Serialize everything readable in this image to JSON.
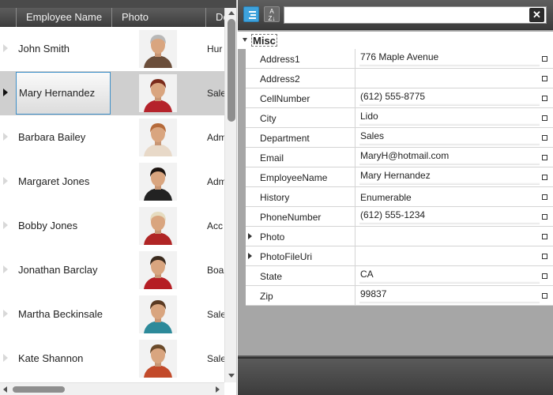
{
  "grid": {
    "columns": [
      "Employee Name",
      "Photo",
      "De"
    ],
    "rows": [
      {
        "name": "John Smith",
        "dept": "Hur",
        "photo_icon": "person-photo-icon",
        "selected": false
      },
      {
        "name": "Mary Hernandez",
        "dept": "Sale",
        "photo_icon": "person-photo-icon",
        "selected": true
      },
      {
        "name": "Barbara Bailey",
        "dept": "Adm",
        "photo_icon": "person-photo-icon",
        "selected": false
      },
      {
        "name": "Margaret Jones",
        "dept": "Adm",
        "photo_icon": "person-photo-icon",
        "selected": false
      },
      {
        "name": "Bobby Jones",
        "dept": "Acc",
        "photo_icon": "person-photo-icon",
        "selected": false
      },
      {
        "name": "Jonathan Barclay",
        "dept": "Boa",
        "photo_icon": "person-photo-icon",
        "selected": false
      },
      {
        "name": "Martha Beckinsale",
        "dept": "Sale",
        "photo_icon": "person-photo-icon",
        "selected": false
      },
      {
        "name": "Kate Shannon",
        "dept": "Sale",
        "photo_icon": "person-photo-icon",
        "selected": false
      }
    ]
  },
  "property_grid": {
    "toolbar": {
      "categorize_icon": "categorize-icon",
      "sort_az_label_top": "A",
      "sort_az_label_bottom": "Z",
      "search_value": "",
      "clear_label": "✕"
    },
    "category": "Misc",
    "properties": [
      {
        "name": "Address1",
        "value": "776 Maple Avenue",
        "editable": true,
        "expandable": false
      },
      {
        "name": "Address2",
        "value": "",
        "editable": false,
        "expandable": false
      },
      {
        "name": "CellNumber",
        "value": "(612) 555-8775",
        "editable": true,
        "expandable": false
      },
      {
        "name": "City",
        "value": "Lido",
        "editable": true,
        "expandable": false
      },
      {
        "name": "Department",
        "value": "Sales",
        "editable": true,
        "expandable": false
      },
      {
        "name": "Email",
        "value": "MaryH@hotmail.com",
        "editable": true,
        "expandable": false
      },
      {
        "name": "EmployeeName",
        "value": "Mary Hernandez",
        "editable": true,
        "expandable": false
      },
      {
        "name": "History",
        "value": "Enumerable",
        "editable": false,
        "expandable": false
      },
      {
        "name": "PhoneNumber",
        "value": "(612) 555-1234",
        "editable": true,
        "expandable": false
      },
      {
        "name": "Photo",
        "value": "",
        "editable": false,
        "expandable": true
      },
      {
        "name": "PhotoFileUri",
        "value": "",
        "editable": false,
        "expandable": true
      },
      {
        "name": "State",
        "value": "CA",
        "editable": true,
        "expandable": false
      },
      {
        "name": "Zip",
        "value": "99837",
        "editable": true,
        "expandable": false
      }
    ]
  }
}
